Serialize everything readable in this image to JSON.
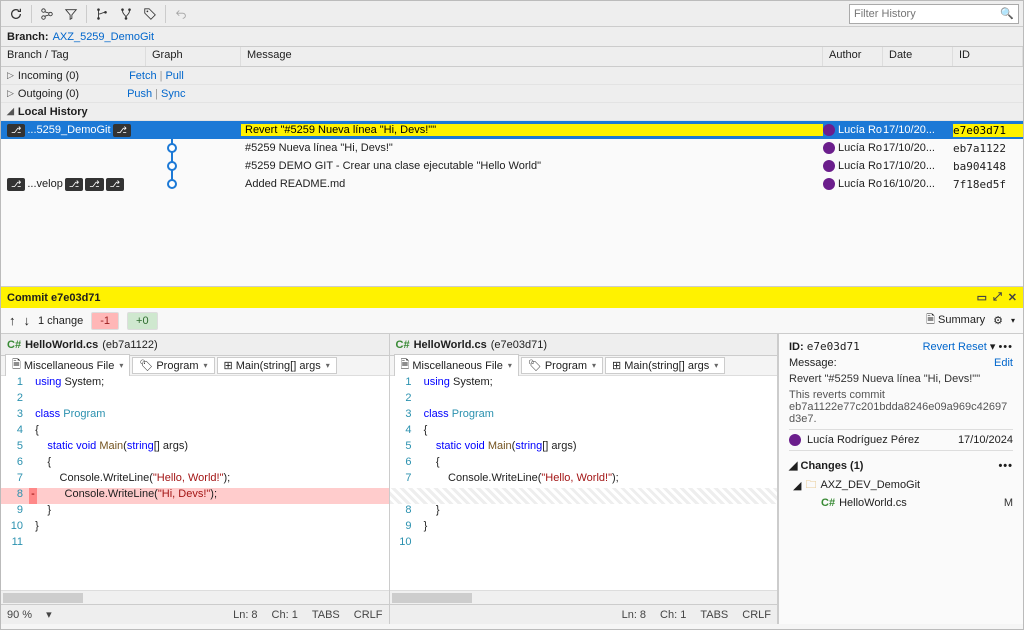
{
  "filter_placeholder": "Filter History",
  "branch_label": "Branch:",
  "branch_name": "AXZ_5259_DemoGit",
  "columns": {
    "branch": "Branch / Tag",
    "graph": "Graph",
    "msg": "Message",
    "author": "Author",
    "date": "Date",
    "id": "ID"
  },
  "sections": {
    "incoming": {
      "label": "Incoming (0)",
      "fetch": "Fetch",
      "pull": "Pull"
    },
    "outgoing": {
      "label": "Outgoing (0)",
      "push": "Push",
      "sync": "Sync"
    },
    "local": "Local History"
  },
  "commits": [
    {
      "branch": "...5259_DemoGit",
      "msg": "Revert \"#5259 Nueva línea \"Hi, Devs!\"\"",
      "author": "Lucía Ro",
      "date": "17/10/20...",
      "id": "e7e03d71",
      "selected": true,
      "highlight": true
    },
    {
      "msg": "#5259 Nueva línea \"Hi, Devs!\"",
      "author": "Lucía Ro",
      "date": "17/10/20...",
      "id": "eb7a1122"
    },
    {
      "msg": "#5259 DEMO GIT - Crear una clase ejecutable \"Hello World\"",
      "author": "Lucía Ro",
      "date": "17/10/20...",
      "id": "ba904148"
    },
    {
      "branch": "...velop",
      "msg": "Added README.md",
      "author": "Lucía Ro",
      "date": "16/10/20...",
      "id": "7f18ed5f"
    }
  ],
  "commit_header": "Commit e7e03d71",
  "change_summary": {
    "count": "1 change",
    "neg": "-1",
    "pos": "+0",
    "summary_btn": "Summary"
  },
  "left_file": {
    "name": "HelloWorld.cs",
    "rev": "(eb7a1122)"
  },
  "right_file": {
    "name": "HelloWorld.cs",
    "rev": "(e7e03d71)"
  },
  "crumbs": {
    "project": "Miscellaneous File",
    "cls": "Program",
    "method": "Main(string[] args"
  },
  "status_left": {
    "zoom": "90 %",
    "ln": "Ln: 8",
    "ch": "Ch: 1",
    "tabs": "TABS",
    "crlf": "CRLF"
  },
  "status_right": {
    "ln": "Ln: 8",
    "ch": "Ch: 1",
    "tabs": "TABS",
    "crlf": "CRLF"
  },
  "details": {
    "id_label": "ID:",
    "id": "e7e03d71",
    "revert": "Revert",
    "reset": "Reset",
    "dots": "•••",
    "msg_label": "Message:",
    "edit": "Edit",
    "msg": "Revert \"#5259 Nueva línea \"Hi, Devs!\"\"",
    "reverts_label": "This reverts commit",
    "reverts_hash": "eb7a1122e77c201bdda8246e09a969c42697d3e7.",
    "author": "Lucía Rodríguez Pérez",
    "author_date": "17/10/2024",
    "changes_label": "Changes (1)",
    "folder": "AXZ_DEV_DemoGit",
    "file": "HelloWorld.cs",
    "file_status": "M"
  }
}
